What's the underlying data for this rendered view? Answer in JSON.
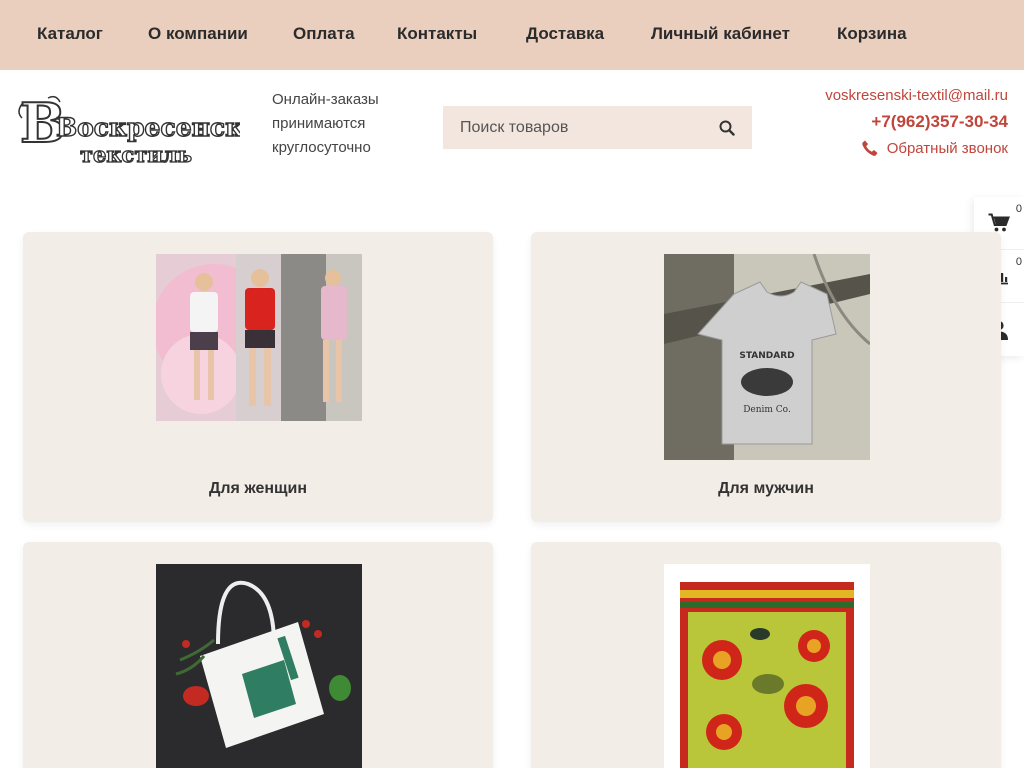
{
  "nav": {
    "items": [
      "Каталог",
      "О компании",
      "Оплата",
      "Контакты",
      "Доставка",
      "Личный кабинет",
      "Корзина"
    ]
  },
  "logo": {
    "line1": "Воскресенский",
    "line2": "текстиль"
  },
  "header": {
    "hours_line1": "Онлайн-заказы",
    "hours_line2": "принимаются",
    "hours_line3": "круглосуточно"
  },
  "search": {
    "placeholder": "Поиск товаров",
    "icon": "search-icon"
  },
  "contacts": {
    "email": "voskresenski-textil@mail.ru",
    "phone": "+7(962)357-30-34",
    "callback": "Обратный звонок",
    "accent_color": "#c0463c"
  },
  "sidebar": {
    "cart_count": "0",
    "compare_count": "0",
    "icons": [
      "cart-icon",
      "compare-icon",
      "user-icon"
    ]
  },
  "categories": [
    {
      "title": "Для женщин"
    },
    {
      "title": "Для мужчин"
    },
    {
      "title": ""
    },
    {
      "title": ""
    }
  ],
  "theme": {
    "nav_bg": "#eacfbf",
    "card_bg": "#f3ede7",
    "search_bg": "#f2e6df"
  }
}
